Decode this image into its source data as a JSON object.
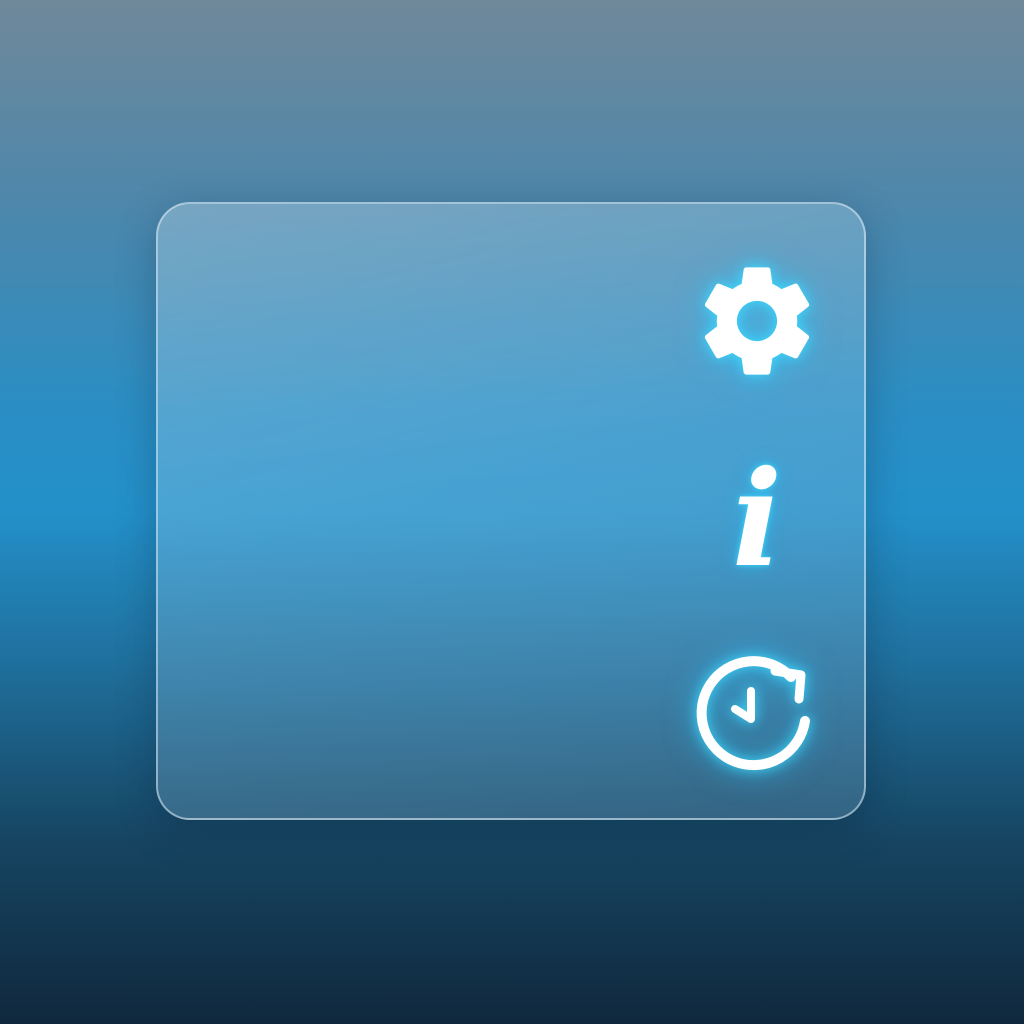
{
  "panel": {
    "icons": [
      {
        "name": "gear-icon",
        "action": "settings"
      },
      {
        "name": "info-icon",
        "glyph": "i"
      },
      {
        "name": "history-icon",
        "action": "history"
      }
    ]
  },
  "colors": {
    "icon_fill": "#ffffff",
    "icon_glow": "#3cdcff",
    "panel_border": "#dcebf5"
  }
}
